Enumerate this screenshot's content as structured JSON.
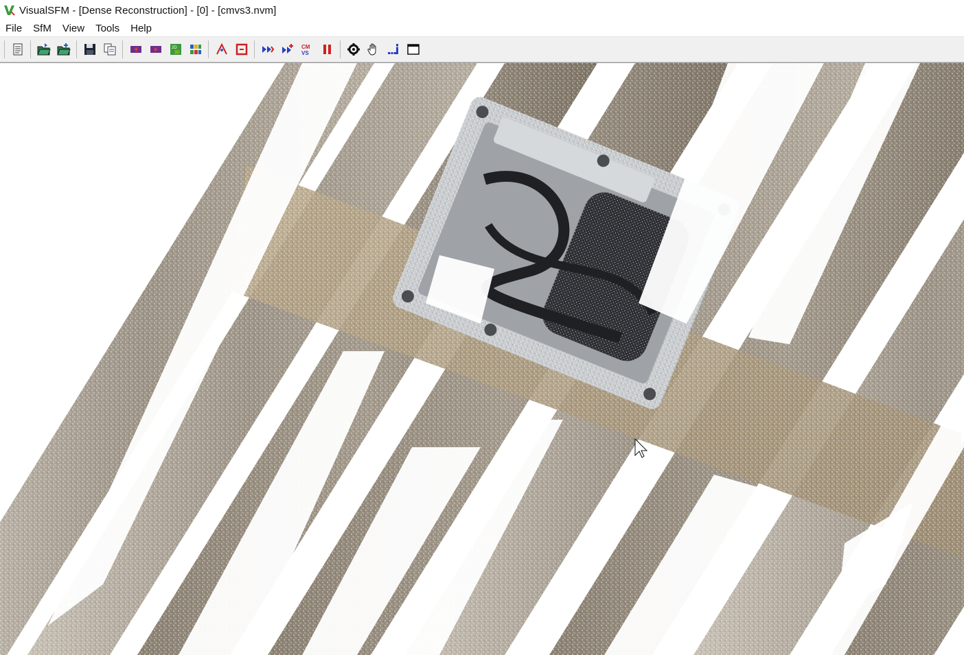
{
  "window": {
    "title": "VisualSFM - [Dense Reconstruction] - [0] - [cmvs3.nvm]",
    "icon": "visualsfm-logo-icon"
  },
  "menu": {
    "items": [
      {
        "label": "File"
      },
      {
        "label": "SfM"
      },
      {
        "label": "View"
      },
      {
        "label": "Tools"
      },
      {
        "label": "Help"
      }
    ]
  },
  "toolbar": {
    "buttons": [
      {
        "icon": "log-window-icon"
      },
      {
        "icon": "open-folder-icon"
      },
      {
        "icon": "add-images-icon"
      },
      {
        "icon": "save-icon"
      },
      {
        "icon": "copy-icon"
      },
      {
        "icon": "previous-model-icon"
      },
      {
        "icon": "next-model-icon"
      },
      {
        "icon": "switch-2d-3d-icon"
      },
      {
        "icon": "thumbnails-grid-icon"
      },
      {
        "icon": "show-features-icon"
      },
      {
        "icon": "show-match-icon"
      },
      {
        "icon": "compute-missing-match-icon"
      },
      {
        "icon": "compute-3d-reconstruction-icon"
      },
      {
        "icon": "run-dense-reconstruction-icon"
      },
      {
        "icon": "pause-icon"
      },
      {
        "icon": "settings-gear-icon"
      },
      {
        "icon": "pan-hand-icon"
      },
      {
        "icon": "ruler-icon"
      },
      {
        "icon": "full-window-icon"
      }
    ]
  },
  "viewport": {
    "content": "dense-point-cloud",
    "colors": {
      "background": "#ffffff",
      "wood_light": "#b9b0a2",
      "wood_dark": "#8a8072",
      "metal": "#c6c9cc",
      "motor": "#2c2e33"
    }
  }
}
